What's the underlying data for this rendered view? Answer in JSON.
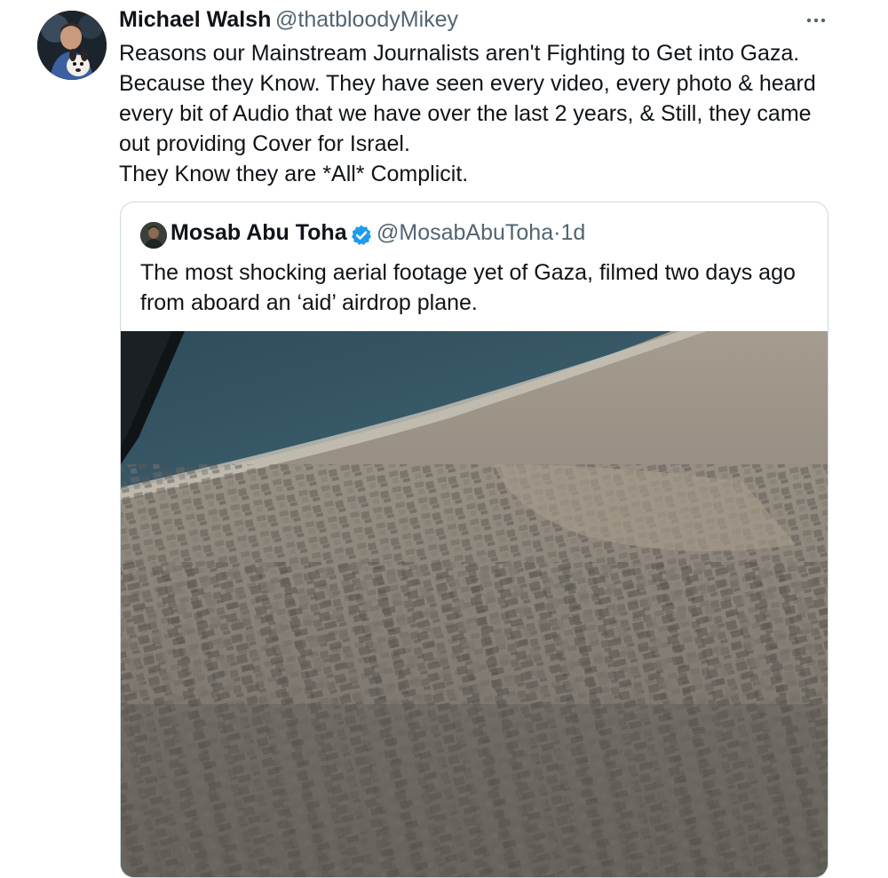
{
  "tweet": {
    "author_name": "Michael Walsh",
    "author_handle": "@thatbloodyMikey",
    "avatar_icon": "profile-photo",
    "more_icon": "more-horizontal-icon",
    "text_lines": [
      "Reasons our Mainstream Journalists aren't Fighting to Get into Gaza.",
      "Because they Know. They have seen every video, every photo & heard",
      "every bit of Audio that we have over the last 2 years, & Still, they came",
      "out providing Cover for Israel.",
      "They Know they are *All* Complicit."
    ]
  },
  "quoted_tweet": {
    "author_name": "Mosab Abu Toha",
    "verified": true,
    "author_handle": "@MosabAbuToha",
    "separator": "·",
    "time_ago": "1d",
    "text_lines": [
      "The most shocking aerial footage yet of Gaza, filmed two days ago",
      "from aboard an ‘aid’ airdrop plane."
    ],
    "media_icon": "aerial-photo"
  },
  "colors": {
    "text_primary": "#0f1419",
    "text_secondary": "#536471",
    "verified_blue": "#1d9bf0",
    "card_border": "#cfd9de"
  }
}
